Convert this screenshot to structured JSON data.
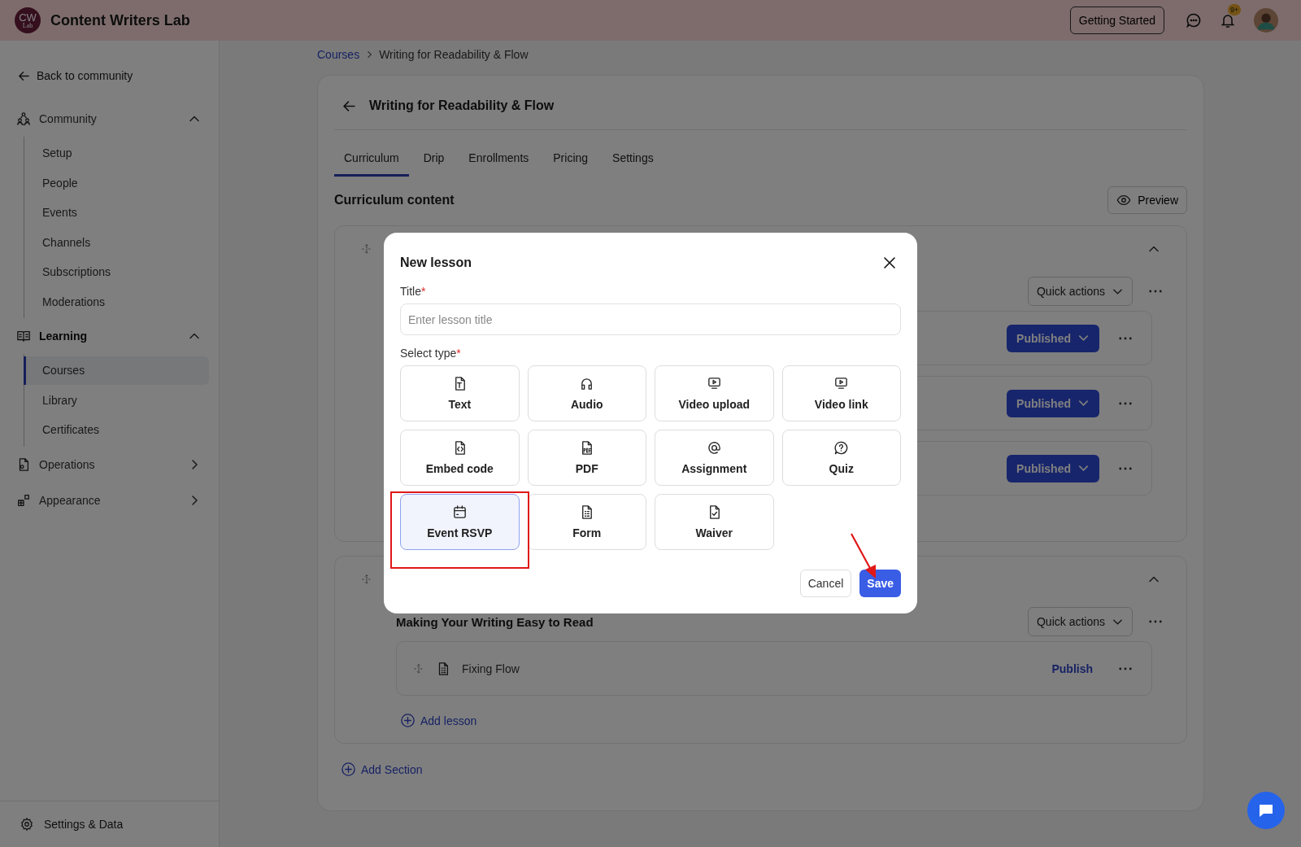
{
  "app": {
    "logo_text": "CW",
    "logo_subtext": "Lab",
    "name": "Content Writers Lab"
  },
  "header": {
    "getting_started": "Getting Started",
    "notification_badge": "9+"
  },
  "sidebar": {
    "back": "Back to community",
    "groups": [
      {
        "label": "Community",
        "kind": "community",
        "expanded": true,
        "children": [
          {
            "label": "Setup",
            "selected": false
          },
          {
            "label": "People",
            "selected": false
          },
          {
            "label": "Events",
            "selected": false
          },
          {
            "label": "Channels",
            "selected": false
          },
          {
            "label": "Subscriptions",
            "selected": false
          },
          {
            "label": "Moderations",
            "selected": false
          }
        ]
      },
      {
        "label": "Learning",
        "kind": "book",
        "expanded": true,
        "children": [
          {
            "label": "Courses",
            "selected": true
          },
          {
            "label": "Library",
            "selected": false
          },
          {
            "label": "Certificates",
            "selected": false
          }
        ]
      },
      {
        "label": "Operations",
        "kind": "operations",
        "expanded": false
      },
      {
        "label": "Appearance",
        "kind": "appearance",
        "expanded": false
      }
    ],
    "footer": "Settings & Data"
  },
  "breadcrumb": [
    {
      "label": "Courses",
      "kind": "link"
    },
    {
      "label": "Writing for Readability & Flow",
      "kind": "current"
    }
  ],
  "course": {
    "title": "Writing for Readability & Flow",
    "tabs": [
      {
        "label": "Curriculum",
        "selected": true
      },
      {
        "label": "Drip",
        "selected": false
      },
      {
        "label": "Enrollments",
        "selected": false
      },
      {
        "label": "Pricing",
        "selected": false
      },
      {
        "label": "Settings",
        "selected": false
      }
    ],
    "content_heading": "Curriculum content",
    "preview": "Preview",
    "sections": [
      {
        "expanded": true,
        "quick_actions": "Quick actions",
        "lessons": [
          {
            "status": "Published",
            "kind": "dropdown"
          },
          {
            "status": "Published",
            "kind": "dropdown"
          },
          {
            "status": "Published",
            "kind": "dropdown"
          }
        ]
      },
      {
        "expanded": true,
        "title": "Making Your Writing Easy to Read",
        "quick_actions": "Quick actions",
        "lessons": [
          {
            "title": "Fixing Flow",
            "status": "Publish",
            "kind": "link"
          }
        ],
        "add_lesson": "Add lesson"
      }
    ],
    "add_section": "Add Section"
  },
  "modal": {
    "title": "New lesson",
    "title_field": {
      "label": "Title",
      "required_mark": "*",
      "placeholder": "Enter lesson title"
    },
    "type_field": {
      "label": "Select type",
      "required_mark": "*"
    },
    "types": [
      {
        "label": "Text",
        "kind": "text",
        "selected": false
      },
      {
        "label": "Audio",
        "kind": "audio",
        "selected": false
      },
      {
        "label": "Video upload",
        "kind": "video",
        "selected": false
      },
      {
        "label": "Video link",
        "kind": "video",
        "selected": false
      },
      {
        "label": "Embed code",
        "kind": "embed",
        "selected": false
      },
      {
        "label": "PDF",
        "kind": "pdf",
        "selected": false
      },
      {
        "label": "Assignment",
        "kind": "at",
        "selected": false
      },
      {
        "label": "Quiz",
        "kind": "quiz",
        "selected": false
      },
      {
        "label": "Event RSVP",
        "kind": "calendar",
        "selected": true
      },
      {
        "label": "Form",
        "kind": "form",
        "selected": false
      },
      {
        "label": "Waiver",
        "kind": "waiver",
        "selected": false
      }
    ],
    "cancel": "Cancel",
    "save": "Save"
  },
  "annotations": {
    "highlight_box": true,
    "arrow": true
  }
}
